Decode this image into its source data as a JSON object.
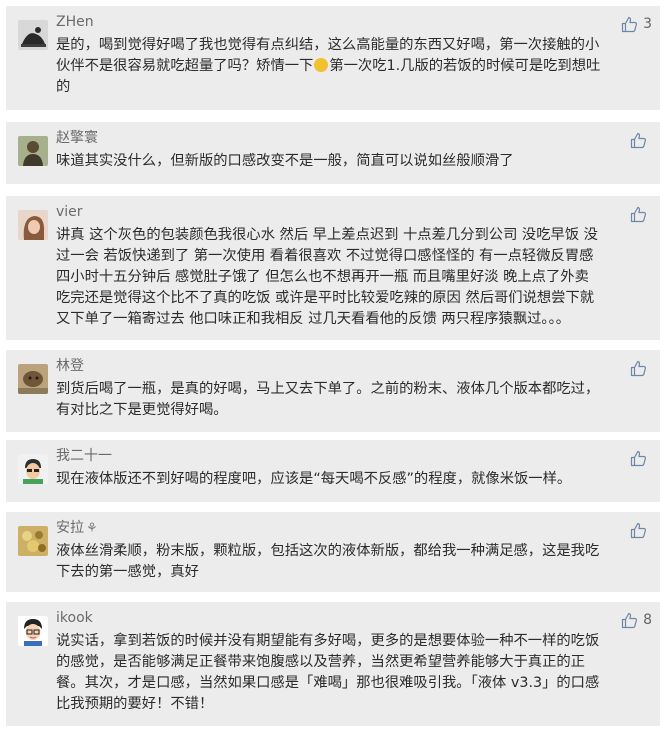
{
  "comments": [
    {
      "username": "ZHen",
      "likes": "3",
      "text_before": "是的，喝到觉得好喝了我也觉得有点纠结，这么高能量的东西又好喝，第一次接触的小\n伙伴不是很容易就吃超量了吗？矫情一下",
      "emoji": "smirk-emoji",
      "text_after": "第一次吃1.几版的若饭的时候可是吃到想吐\n的"
    },
    {
      "username": "赵擎寰",
      "likes": "",
      "text": "味道其实没什么，但新版的口感改变不是一般，简直可以说如丝般顺滑了"
    },
    {
      "username": "vier",
      "likes": "",
      "text": "讲真 这个灰色的包装颜色我很心水 然后 早上差点迟到 十点差几分到公司 没吃早饭 没\n过一会 若饭快递到了 第一次使用 看着很喜欢 不过觉得口感怪怪的 有一点轻微反胃感\n四小时十五分钟后 感觉肚子饿了 但怎么也不想再开一瓶 而且嘴里好淡 晚上点了外卖\n吃完还是觉得这个比不了真的吃饭 或许是平时比较爱吃辣的原因 然后哥们说想尝下就\n又下单了一箱寄过去 他口味正和我相反 过几天看看他的反馈 两只程序猿飘过。。。"
    },
    {
      "username": "林登",
      "likes": "",
      "text": "到货后喝了一瓶，是真的好喝，马上又去下单了。之前的粉末、液体几个版本都吃过，\n有对比之下是更觉得好喝。"
    },
    {
      "username": "我二十一",
      "likes": "",
      "text": "现在液体版还不到好喝的程度吧，应该是“每天喝不反感”的程度，就像米饭一样。"
    },
    {
      "username": "安拉",
      "username_suffix": "⚘",
      "likes": "",
      "text": "液体丝滑柔顺，粉末版，颗粒版，包括这次的液体新版，都给我一种满足感，这是我吃\n下去的第一感觉，真好"
    },
    {
      "username": "ikook",
      "likes": "8",
      "text": "说实话，拿到若饭的时候并没有期望能有多好喝，更多的是想要体验一种不一样的吃饭\n的感觉，是否能够满足正餐带来饱腹感以及营养，当然更希望营养能够大于真正的正\n餐。其次，才是口感，当然如果口感是「难喝」那也很难吸引我。「液体 v3.3」的口感\n比我预期的要好！不错！"
    }
  ],
  "colors": {
    "card_background": "#ececec",
    "text": "#2b2b2b",
    "username": "#6b6b6b",
    "like_icon": "#6d86a8"
  }
}
